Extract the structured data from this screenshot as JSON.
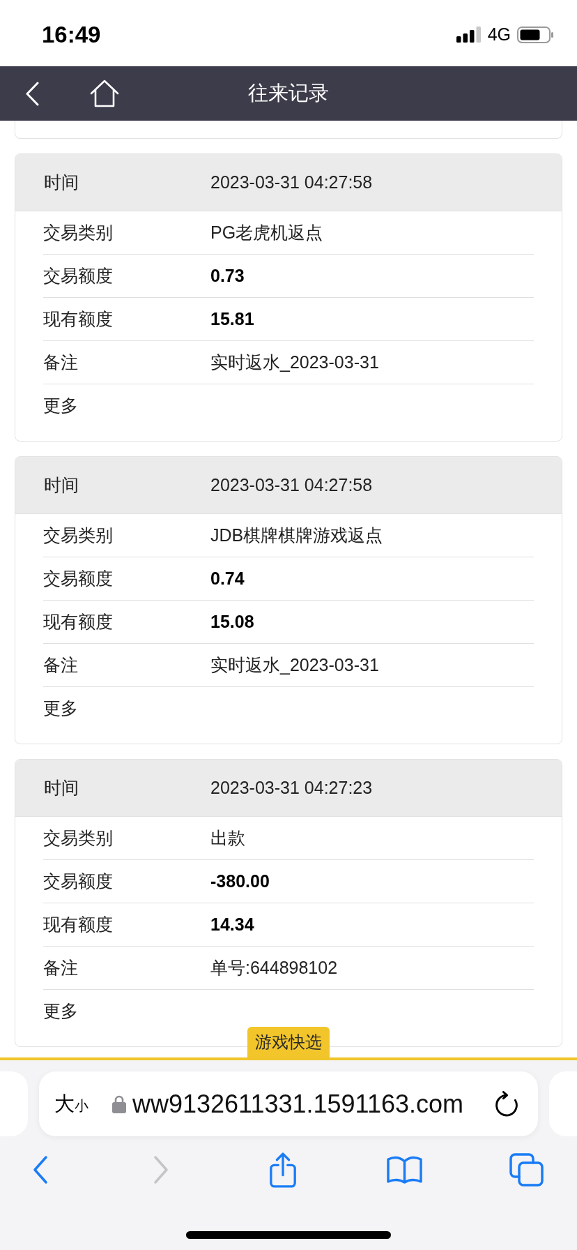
{
  "status_bar": {
    "time": "16:49",
    "network": "4G"
  },
  "nav_bar": {
    "title": "往来记录"
  },
  "records": [
    {
      "time_label": "时间",
      "time": "2023-03-31 04:27:58",
      "fields": [
        {
          "label": "交易类别",
          "value": "PG老虎机返点",
          "kind": "text"
        },
        {
          "label": "交易额度",
          "value": "0.73",
          "kind": "amount"
        },
        {
          "label": "现有额度",
          "value": "15.81",
          "kind": "amount"
        },
        {
          "label": "备注",
          "value": "实时返水_2023-03-31",
          "kind": "text"
        }
      ],
      "more": "更多"
    },
    {
      "time_label": "时间",
      "time": "2023-03-31 04:27:58",
      "fields": [
        {
          "label": "交易类别",
          "value": "JDB棋牌棋牌游戏返点",
          "kind": "text"
        },
        {
          "label": "交易额度",
          "value": "0.74",
          "kind": "amount"
        },
        {
          "label": "现有额度",
          "value": "15.08",
          "kind": "amount"
        },
        {
          "label": "备注",
          "value": "实时返水_2023-03-31",
          "kind": "text"
        }
      ],
      "more": "更多"
    },
    {
      "time_label": "时间",
      "time": "2023-03-31 04:27:23",
      "fields": [
        {
          "label": "交易类别",
          "value": "出款",
          "kind": "text"
        },
        {
          "label": "交易额度",
          "value": "-380.00",
          "kind": "amount"
        },
        {
          "label": "现有额度",
          "value": "14.34",
          "kind": "amount"
        },
        {
          "label": "备注",
          "value": "单号:644898102",
          "kind": "text"
        }
      ],
      "more": "更多"
    }
  ],
  "quick_tab": "游戏快选",
  "browser": {
    "text_size": {
      "large": "大",
      "small": "小"
    },
    "url": "ww9132611331.1591163.com",
    "toolbar": [
      {
        "kind": "back",
        "disabled": false
      },
      {
        "kind": "forward",
        "disabled": true
      },
      {
        "kind": "share",
        "disabled": false
      },
      {
        "kind": "bookmarks",
        "disabled": false
      },
      {
        "kind": "tabs",
        "disabled": false
      }
    ]
  }
}
